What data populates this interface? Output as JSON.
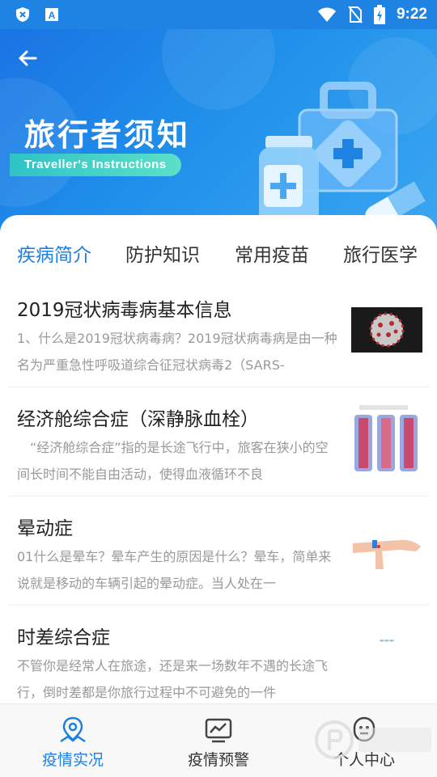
{
  "status_bar": {
    "time": "9:22"
  },
  "banner": {
    "title": "旅行者须知",
    "subtitle": "Traveller's Instructions"
  },
  "tabs": [
    {
      "label": "疾病简介",
      "active": true
    },
    {
      "label": "防护知识",
      "active": false
    },
    {
      "label": "常用疫苗",
      "active": false
    },
    {
      "label": "旅行医学",
      "active": false
    }
  ],
  "articles": [
    {
      "title": "2019冠状病毒病基本信息",
      "desc": "1、什么是2019冠状病毒病？2019冠状病毒病是由一种名为严重急性呼吸道综合征冠状病毒2（SARS-",
      "image_icon": "virus-image"
    },
    {
      "title": "经济舱综合症（深静脉血栓）",
      "desc": "“经济舱综合症”指的是长途飞行中，旅客在狭小的空间长时间不能自由活动，使得血液循环不良",
      "image_icon": "thrombosis-diagram-image"
    },
    {
      "title": "晕动症",
      "desc": "01什么是晕车？晕车产生的原因是什么？晕车，简单来说就是移动的车辆引起的晕动症。当人处在一",
      "image_icon": "wrist-pressure-image"
    },
    {
      "title": "时差综合症",
      "desc": "不管你是经常人在旅途，还是来一场数年不遇的长途飞行，倒时差都是你旅行过程中不可避免的一件",
      "image_icon": "clock-image"
    }
  ],
  "bottom_nav": [
    {
      "label": "疫情实况",
      "icon": "map-pin-icon",
      "active": true
    },
    {
      "label": "疫情预警",
      "icon": "chart-monitor-icon",
      "active": false
    },
    {
      "label": "个人中心",
      "icon": "user-face-icon",
      "active": false
    }
  ],
  "colors": {
    "primary": "#1f7fe0",
    "banner": "#1f83e4",
    "accent": "#3cd0c6"
  }
}
